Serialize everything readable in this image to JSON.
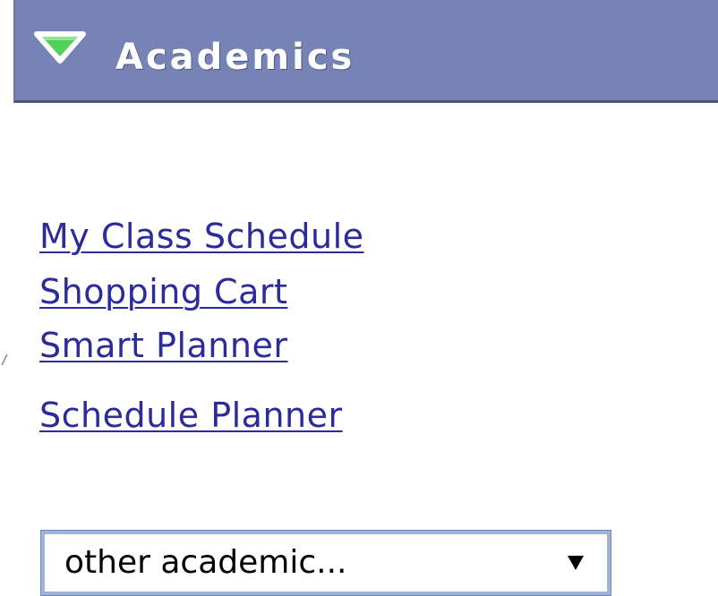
{
  "header": {
    "title": "Academics",
    "toggle_icon": "triangle-down-icon",
    "background_color": "#7583b6",
    "toggle_color": "#4fd15a"
  },
  "links": [
    {
      "label": "My Class Schedule"
    },
    {
      "label": "Shopping Cart"
    },
    {
      "label": "Smart Planner"
    },
    {
      "label": "Schedule Planner"
    }
  ],
  "dropdown": {
    "selected": "other academic...",
    "arrow_icon": "caret-down-icon"
  },
  "colors": {
    "link": "#2b2b9a",
    "dropdown_border": "#9fb3d9"
  }
}
